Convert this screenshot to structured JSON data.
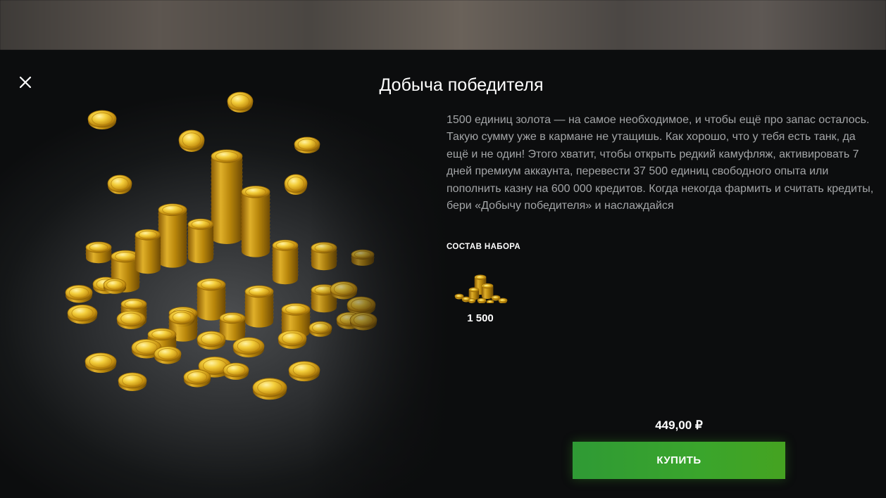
{
  "header": {
    "close_icon": "close-icon",
    "title": "Добыча победителя"
  },
  "description": "1500 единиц золота — на самое необходимое, и чтобы ещё про запас осталось.\nТакую сумму уже в кармане не утащишь. Как хорошо, что у тебя есть танк, да ещё и не один! Этого хватит, чтобы открыть редкий камуфляж, активировать 7 дней премиум аккаунта, перевести 37 500 единиц свободного опыта или пополнить казну на 600 000 кредитов. Когда некогда фармить и считать кредиты, бери «Добычу победителя» и наслаждайся",
  "bundle": {
    "heading": "СОСТАВ НАБОРА",
    "items": [
      {
        "icon": "gold-coins-icon",
        "amount": "1 500"
      }
    ]
  },
  "purchase": {
    "price": "449,00 ₽",
    "buy_label": "КУПИТЬ",
    "button_color": "#3aa52c"
  },
  "artwork": {
    "icon": "gold-coins-pile-icon"
  },
  "colors": {
    "background": "#0c0d0e",
    "accent_green": "#3aa52c",
    "gold": "#e2b521",
    "text_secondary": "#a3a5a7"
  }
}
